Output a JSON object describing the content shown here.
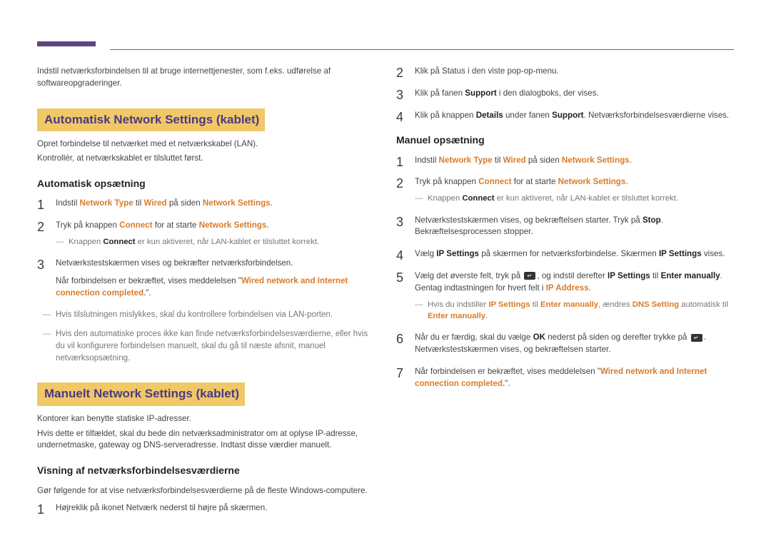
{
  "left": {
    "intro": "Indstil netværksforbindelsen til at bruge internettjenester, som f.eks. udførelse af softwareopgraderinger.",
    "section1": {
      "title": "Automatisk Network Settings (kablet)",
      "desc1": "Opret forbindelse til netværket med et netværkskabel (LAN).",
      "desc2": "Kontrollér, at netværkskablet er tilsluttet først.",
      "subtitle": "Automatisk opsætning",
      "steps": {
        "s1_a": "Indstil ",
        "s1_b": "Network Type",
        "s1_c": " til ",
        "s1_d": "Wired",
        "s1_e": " på siden ",
        "s1_f": "Network Settings",
        "s1_g": ".",
        "s2_a": "Tryk på knappen ",
        "s2_b": "Connect",
        "s2_c": " for at starte ",
        "s2_d": "Network Settings",
        "s2_e": ".",
        "s2_note_a": "Knappen ",
        "s2_note_b": "Connect",
        "s2_note_c": " er kun aktiveret, når LAN-kablet er tilsluttet korrekt.",
        "s3_a": "Netværkstestskærmen vises og bekræfter netværksforbindelsen.",
        "s3_b": "Når forbindelsen er bekræftet, vises meddelelsen \"",
        "s3_c": "Wired network and Internet connection completed.",
        "s3_d": "\"."
      },
      "after_note1": "Hvis tilslutningen mislykkes, skal du kontrollere forbindelsen via LAN-porten.",
      "after_note2": "Hvis den automatiske proces ikke kan finde netværksforbindelsesværdierne, eller hvis du vil konfigurere forbindelsen manuelt, skal du gå til næste afsnit, manuel netværksopsætning."
    },
    "section2": {
      "title": "Manuelt Network Settings (kablet)",
      "desc1": "Kontorer kan benytte statiske IP-adresser.",
      "desc2": "Hvis dette er tilfældet, skal du bede din netværksadministrator om at oplyse IP-adresse, undernetmaske, gateway og DNS-serveradresse. Indtast disse værdier manuelt.",
      "subtitle": "Visning af netværksforbindelsesværdierne",
      "intro": "Gør følgende for at vise netværksforbindelsesværdierne på de fleste Windows-computere.",
      "step1": "Højreklik på ikonet Netværk nederst til højre på skærmen."
    }
  },
  "right": {
    "top_steps": {
      "s2": "Klik på Status i den viste pop-op-menu.",
      "s3_a": "Klik på fanen ",
      "s3_b": "Support",
      "s3_c": " i den dialogboks, der vises.",
      "s4_a": "Klik på knappen ",
      "s4_b": "Details",
      "s4_c": " under fanen ",
      "s4_d": "Support",
      "s4_e": ". Netværksforbindelsesværdierne vises."
    },
    "subtitle": "Manuel opsætning",
    "steps": {
      "s1_a": "Indstil ",
      "s1_b": "Network Type",
      "s1_c": " til ",
      "s1_d": "Wired",
      "s1_e": " på siden ",
      "s1_f": "Network Settings",
      "s1_g": ".",
      "s2_a": "Tryk på knappen ",
      "s2_b": "Connect",
      "s2_c": " for at starte ",
      "s2_d": "Network Settings",
      "s2_e": ".",
      "s2_note_a": "Knappen ",
      "s2_note_b": "Connect",
      "s2_note_c": " er kun aktiveret, når LAN-kablet er tilsluttet korrekt.",
      "s3_a": "Netværkstestskærmen vises, og bekræftelsen starter. Tryk på ",
      "s3_b": "Stop",
      "s3_c": ". Bekræftelsesprocessen stopper.",
      "s4_a": "Vælg ",
      "s4_b": "IP Settings",
      "s4_c": " på skærmen for netværksforbindelse. Skærmen ",
      "s4_d": "IP Settings",
      "s4_e": " vises.",
      "s5_a": "Vælg det øverste felt, tryk på ",
      "s5_b": ", og indstil derefter ",
      "s5_c": "IP Settings",
      "s5_d": " til ",
      "s5_e": "Enter manually",
      "s5_f": ". Gentag indtastningen for hvert felt i ",
      "s5_g": "IP Address",
      "s5_h": ".",
      "s5_note_a": "Hvis du indstiller ",
      "s5_note_b": "IP Settings",
      "s5_note_c": " til ",
      "s5_note_d": "Enter manually",
      "s5_note_e": ", ændres ",
      "s5_note_f": "DNS Setting",
      "s5_note_g": " automatisk til ",
      "s5_note_h": "Enter manually",
      "s5_note_i": ".",
      "s6_a": "Når du er færdig, skal du vælge ",
      "s6_b": "OK",
      "s6_c": " nederst på siden og derefter trykke på ",
      "s6_d": ". Netværkstestskærmen vises, og bekræftelsen starter.",
      "s7_a": "Når forbindelsen er bekræftet, vises meddelelsen \"",
      "s7_b": "Wired network and Internet connection completed.",
      "s7_c": "\"."
    }
  }
}
